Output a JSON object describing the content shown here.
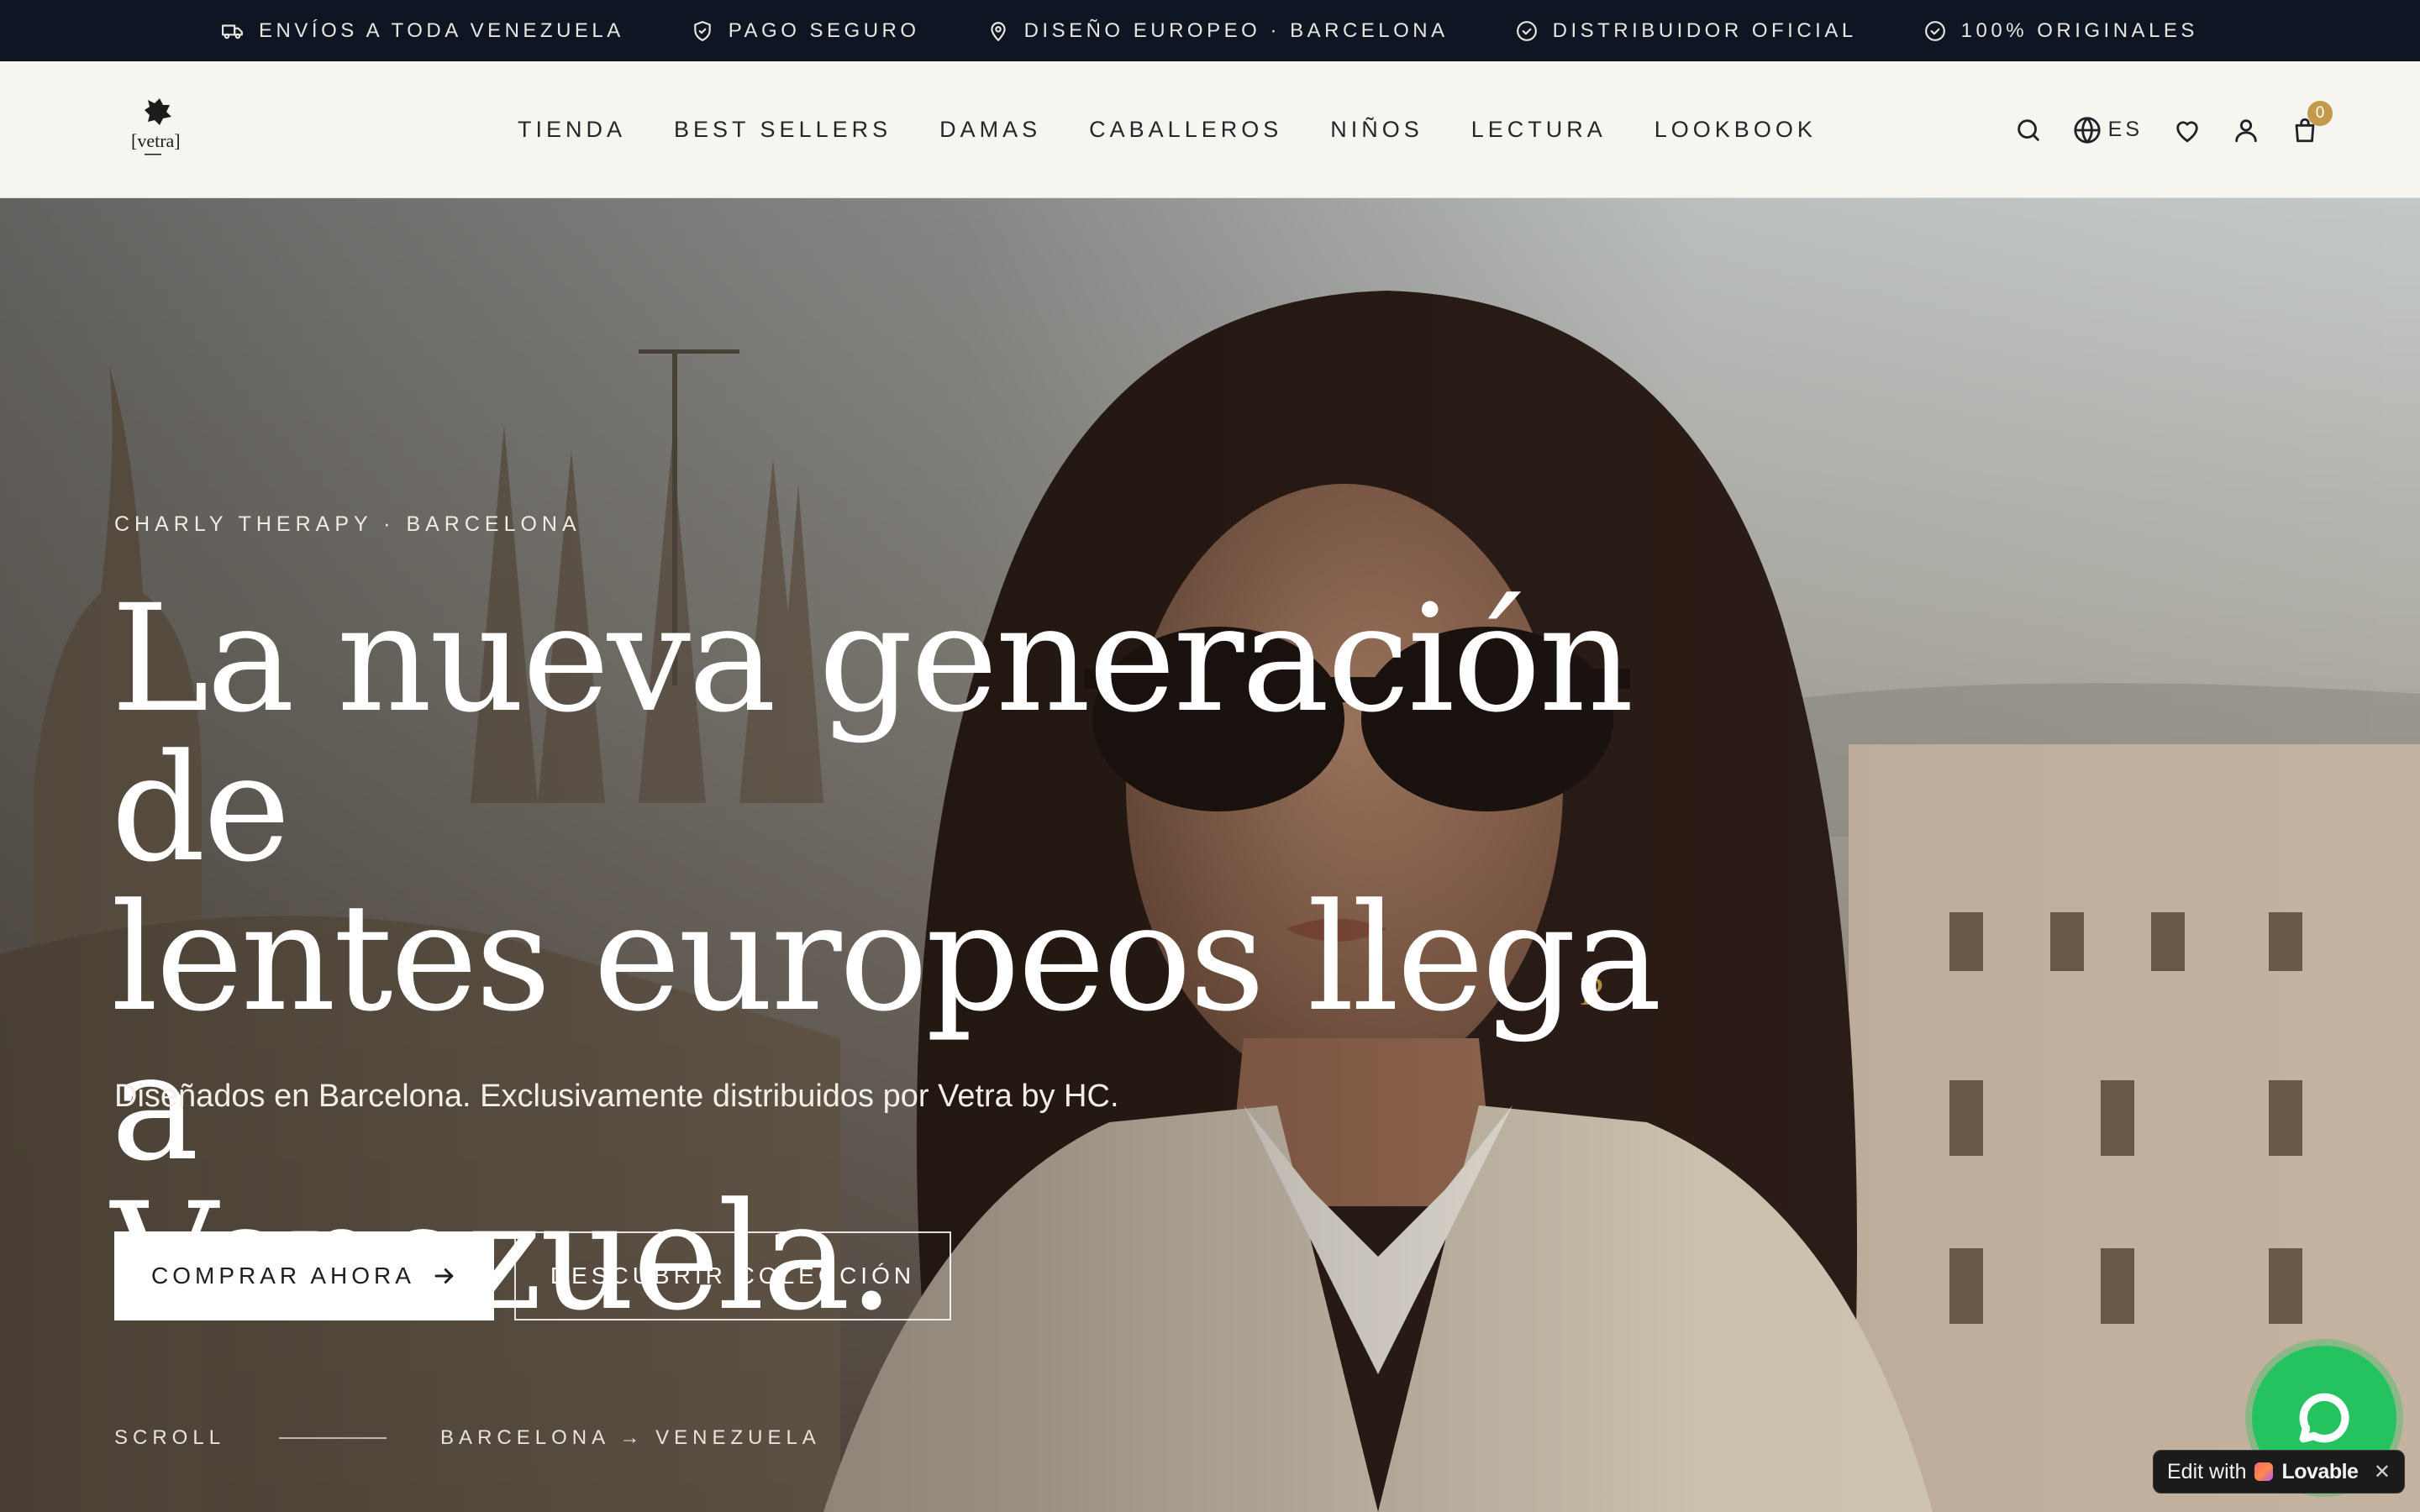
{
  "announcement": {
    "items": [
      {
        "icon": "truck-icon",
        "label": "ENVÍOS A TODA VENEZUELA"
      },
      {
        "icon": "shield-icon",
        "label": "PAGO SEGURO"
      },
      {
        "icon": "map-pin-icon",
        "label": "DISEÑO EUROPEO · BARCELONA"
      },
      {
        "icon": "check-circle-icon",
        "label": "DISTRIBUIDOR OFICIAL"
      },
      {
        "icon": "check-circle-icon",
        "label": "100% ORIGINALES"
      }
    ]
  },
  "header": {
    "logo_text": "[vetra]",
    "nav": [
      "TIENDA",
      "BEST SELLERS",
      "DAMAS",
      "CABALLEROS",
      "NIÑOS",
      "LECTURA",
      "LOOKBOOK"
    ],
    "language": "ES",
    "cart_count": "0"
  },
  "hero": {
    "eyebrow": "CHARLY THERAPY · BARCELONA",
    "headline_lines": [
      "La nueva generación de",
      "lentes europeos llega a",
      "Venezuela."
    ],
    "subtitle": "Diseñados en Barcelona. Exclusivamente distribuidos por Vetra by HC.",
    "primary_cta": "COMPRAR AHORA",
    "secondary_cta": "DESCUBRIR COLECCIÓN",
    "scroll_label": "SCROLL",
    "route_label": "BARCELONA → VENEZUELA"
  },
  "lovable": {
    "prefix": "Edit with",
    "brand": "Lovable",
    "close": "✕"
  },
  "colors": {
    "topbar": "#0f1623",
    "header_bg": "#f7f5ef",
    "badge": "#c49a4a",
    "whatsapp": "#25c35f"
  }
}
